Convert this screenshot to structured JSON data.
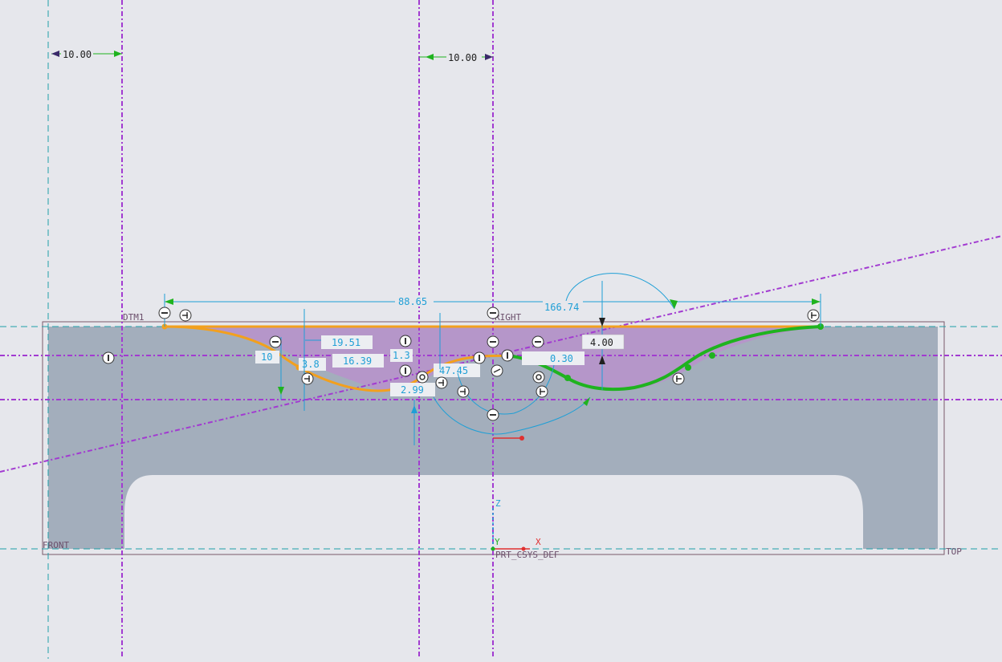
{
  "colors": {
    "background": "#e6e7ec",
    "part_fill": "#a3aebc",
    "part_edge": "#7a5a6a",
    "sketch_region": "#b596c9",
    "datum_plane": "#a23bd1",
    "centerline": "#1f9fa8",
    "dimension": "#1f9fd6",
    "spline_orange": "#f2a01e",
    "spline_green": "#1fb31f",
    "constraint_icon": "#333333"
  },
  "datums": {
    "dtm1": "DTM1",
    "right": "RIGHT",
    "front": "FRONT",
    "top": "TOP",
    "csys": "PRT_CSYS_DEF",
    "axis_x": "X",
    "axis_y": "Y",
    "axis_z": "Z"
  },
  "dimensions": {
    "left_offset": "10.00",
    "center_offset": "10.00",
    "overall_length": "88.65",
    "angle": "166.74",
    "height": "4.00",
    "d1": "19.51",
    "d2": "16.39",
    "d3": "47.45",
    "d4": "2.99",
    "d5": "0.30",
    "d6": "10",
    "d7": "1.3",
    "d8": "3.8"
  },
  "constraint_icons": [
    "horizontal-constraint-icon",
    "vertical-constraint-icon",
    "tangent-constraint-icon",
    "perpendicular-constraint-icon",
    "coincident-constraint-icon",
    "symmetric-constraint-icon"
  ]
}
